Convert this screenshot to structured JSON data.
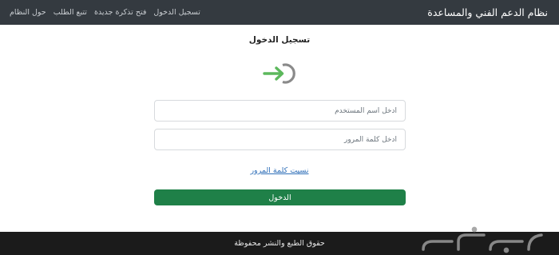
{
  "navbar": {
    "brand": "نظام الدعم الفني والمساعدة",
    "links": [
      "تسجيل الدخول",
      "فتح تذكرة جديدة",
      "تتبع الطلب",
      "حول النظام"
    ]
  },
  "login": {
    "title": "تسجيل الدخول",
    "icon": "sign-in-icon",
    "username_placeholder": "ادخل اسم المستخدم",
    "password_placeholder": "ادخل كلمة المرور",
    "forgot_label": "نسيت كلمة المرور",
    "submit_label": "الدخول"
  },
  "footer": {
    "text": "حقوق الطبع والنشر محفوظة"
  },
  "watermark": {
    "icon": "haraj-logo"
  },
  "colors": {
    "navbar_bg": "#343a40",
    "footer_bg": "#1b1b1b",
    "accent_green": "#1f8048",
    "icon_green": "#5cb85c",
    "link_blue": "#2f6fb8"
  }
}
